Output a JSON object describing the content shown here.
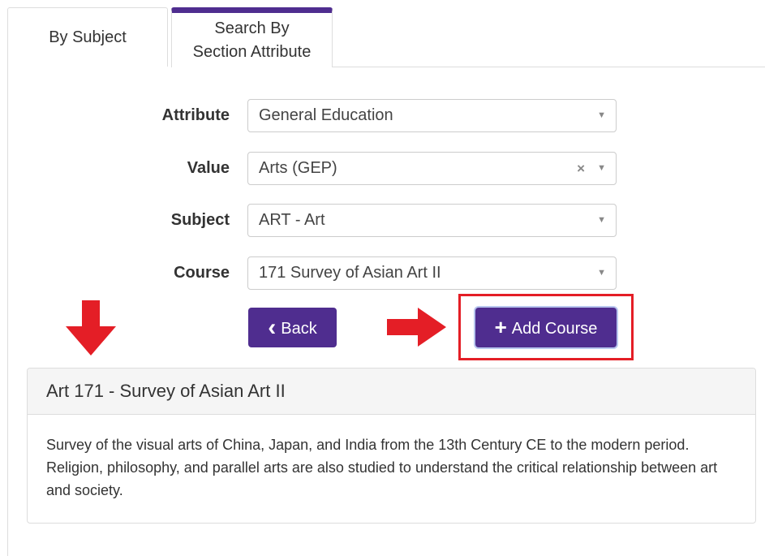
{
  "tabs": [
    {
      "label": "By Subject",
      "active": false
    },
    {
      "label": "Search By Section Attribute",
      "active": true
    }
  ],
  "form": {
    "attribute": {
      "label": "Attribute",
      "value": "General Education"
    },
    "value": {
      "label": "Value",
      "value": "Arts (GEP)",
      "clear_glyph": "×"
    },
    "subject": {
      "label": "Subject",
      "value": "ART - Art"
    },
    "course": {
      "label": "Course",
      "value": "171 Survey of Asian Art II"
    },
    "caret_glyph": "▼"
  },
  "buttons": {
    "back_icon": "‹",
    "back_label": "Back",
    "add_icon": "+",
    "add_label": "Add Course"
  },
  "course_panel": {
    "title": "Art 171 - Survey of Asian Art II",
    "description": "Survey of the visual arts of China, Japan, and India from the 13th Century CE to the modern period. Religion, philosophy, and parallel arts are also studied to understand the critical relationship between art and society."
  },
  "colors": {
    "brand_purple": "#4f2d8f",
    "annotation_red": "#e41e26"
  },
  "icons": {
    "annotation_down": "arrow-down-icon",
    "annotation_right": "arrow-right-icon"
  }
}
